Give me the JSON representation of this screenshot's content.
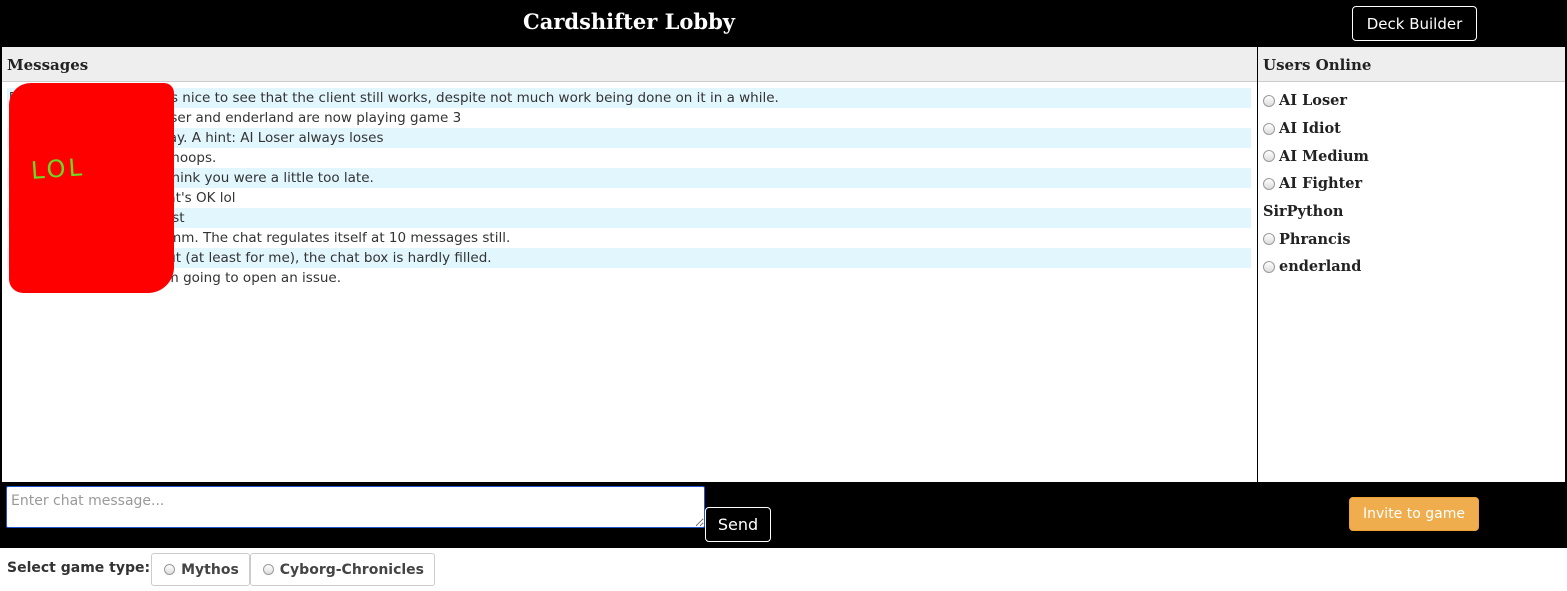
{
  "header": {
    "title": "Cardshifter Lobby",
    "deck_builder_label": "Deck Builder"
  },
  "messages_panel": {
    "heading": "Messages",
    "messages": [
      {
        "text": "[15:28:56] SirPython: It's nice to see that the client still works, despite not much work being done on it in a while."
      },
      {
        "text": "[15:28:57] Server: AI Loser and enderland are now playing game 3"
      },
      {
        "text": "[15:28:57] Phrancis: Okay. A hint: AI Loser always loses"
      },
      {
        "text": "[15:29:03] SirPython: Whoops."
      },
      {
        "text": "[15:29:10] SirPython: I think you were a little too late."
      },
      {
        "text": "[15:29:21] Phrancis: That's OK lol"
      },
      {
        "text": "[15:29:40] SirPython: Test"
      },
      {
        "text": "[15:29:52] SirPython: Hmm. The chat regulates itself at 10 messages still."
      },
      {
        "text": "[15:30:08] SirPython: But (at least for me), the chat box is hardly filled."
      },
      {
        "text": "[15:30:20] SirPython: I'm going to open an issue."
      }
    ],
    "redaction_scribble": "LOL"
  },
  "users_panel": {
    "heading": "Users Online",
    "users": [
      {
        "name": "AI Loser",
        "selectable": true
      },
      {
        "name": "AI Idiot",
        "selectable": true
      },
      {
        "name": "AI Medium",
        "selectable": true
      },
      {
        "name": "AI Fighter",
        "selectable": true
      },
      {
        "name": "SirPython",
        "selectable": false
      },
      {
        "name": "Phrancis",
        "selectable": true
      },
      {
        "name": "enderland",
        "selectable": true
      }
    ]
  },
  "chat": {
    "input_value": "",
    "input_placeholder": "Enter chat message...",
    "send_label": "Send",
    "invite_label": "Invite to game"
  },
  "game_type": {
    "label": "Select game type:",
    "options": [
      "Mythos",
      "Cyborg-Chronicles"
    ]
  },
  "colors": {
    "header_bg": "#000000",
    "alt_row": "#e1f6fd",
    "invite_button": "#f0ad4e",
    "redaction": "#ff0000"
  }
}
